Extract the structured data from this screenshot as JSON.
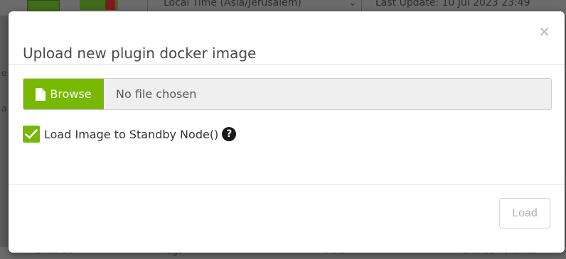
{
  "background": {
    "top_text": "Local Time (Asia/Jerusalem)",
    "top_update": "Last Update: 10 Jul 2023 23:49",
    "chevron": "⌄",
    "bottom_columns": [
      "Enabled",
      "Tags",
      "Port",
      "Shared Volumes"
    ],
    "left_fragments": [
      "e",
      "a"
    ]
  },
  "modal": {
    "title": "Upload new plugin docker image",
    "close_glyph": "×",
    "file_input": {
      "button_label": "Browse",
      "placeholder": "No file chosen"
    },
    "standby_option": {
      "checked": true,
      "label": "Load Image to Standby Node()",
      "help_glyph": "?"
    },
    "load_button": {
      "label": "Load",
      "disabled": true
    }
  },
  "colors": {
    "accent": "#76b900",
    "help_icon": "#1a1a1a",
    "disabled_text": "#b0b0b0"
  },
  "icons": {
    "file": "file-icon",
    "check": "check-icon",
    "help": "question-circle-icon",
    "close": "close-icon"
  }
}
